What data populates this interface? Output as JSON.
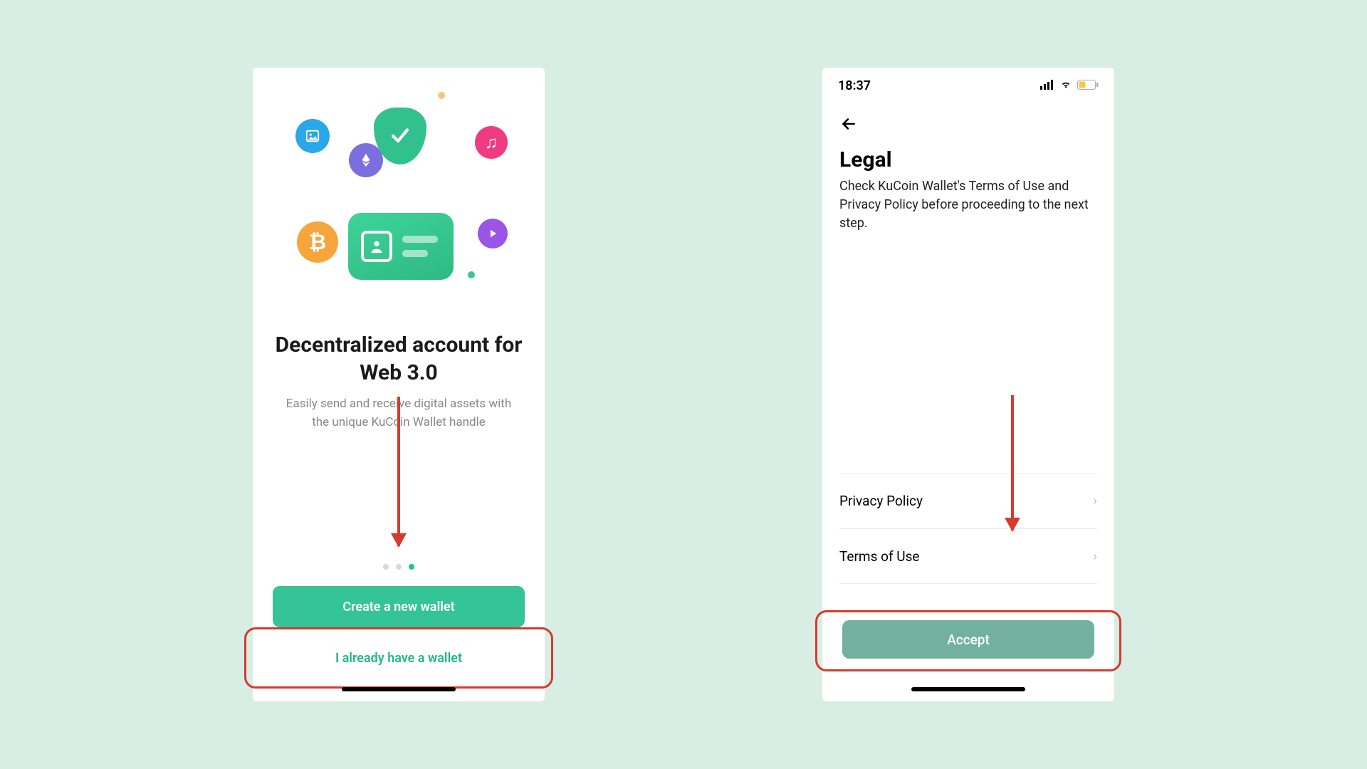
{
  "left": {
    "title": "Decentralized account for Web 3.0",
    "subtitle": "Easily send and receive digital assets with the unique KuCoin Wallet handle",
    "icons": {
      "image": "image-icon",
      "ethereum": "ethereum-icon",
      "shield": "shield-check-icon",
      "music": "music-icon",
      "bitcoin": "bitcoin-icon",
      "idcard": "id-card-icon",
      "play": "play-icon"
    },
    "pager_active_index": 2,
    "btn_create": "Create a new wallet",
    "btn_existing": "I already have a wallet"
  },
  "right": {
    "status_time": "18:37",
    "title": "Legal",
    "description": "Check KuCoin Wallet's Terms of Use and Privacy Policy before proceeding to the next step.",
    "row_privacy": "Privacy Policy",
    "row_terms": "Terms of Use",
    "btn_accept": "Accept"
  },
  "colors": {
    "accent": "#32c08d",
    "highlight": "#d43a2e"
  }
}
